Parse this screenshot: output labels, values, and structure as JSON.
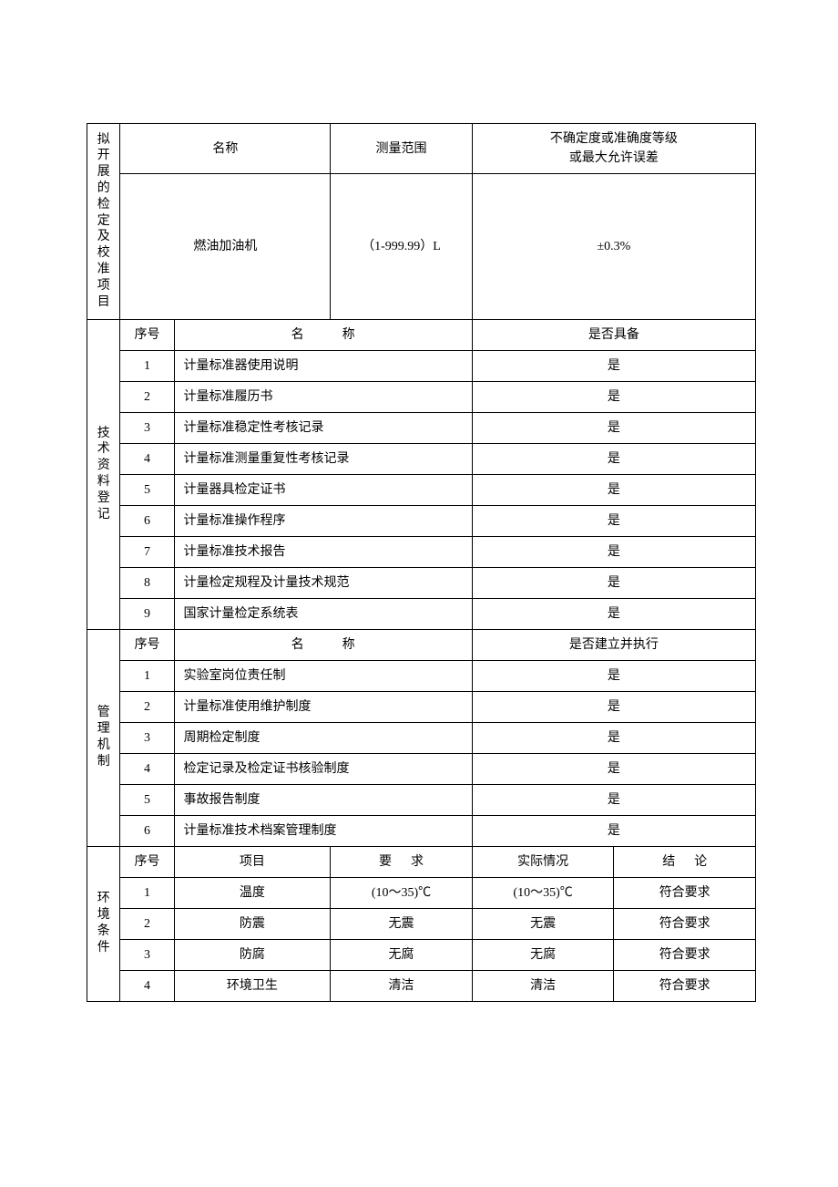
{
  "section1": {
    "label": "拟开展的检定及校准项目",
    "headers": {
      "name": "名称",
      "range": "测量范围",
      "uncertainty": "不确定度或准确度等级\n或最大允许误差"
    },
    "row": {
      "name": "燃油加油机",
      "range": "（1-999.99）L",
      "uncertainty": "±0.3%"
    }
  },
  "section2": {
    "label": "技术资料登记",
    "headers": {
      "seq": "序号",
      "name": "名　　称",
      "status": "是否具备"
    },
    "rows": [
      {
        "seq": "1",
        "name": "计量标准器使用说明",
        "status": "是"
      },
      {
        "seq": "2",
        "name": "计量标准履历书",
        "status": "是"
      },
      {
        "seq": "3",
        "name": "计量标准稳定性考核记录",
        "status": "是"
      },
      {
        "seq": "4",
        "name": "计量标准测量重复性考核记录",
        "status": "是"
      },
      {
        "seq": "5",
        "name": "计量器具检定证书",
        "status": "是"
      },
      {
        "seq": "6",
        "name": "计量标准操作程序",
        "status": "是"
      },
      {
        "seq": "7",
        "name": "计量标准技术报告",
        "status": "是"
      },
      {
        "seq": "8",
        "name": "计量检定规程及计量技术规范",
        "status": "是"
      },
      {
        "seq": "9",
        "name": "国家计量检定系统表",
        "status": "是"
      }
    ]
  },
  "section3": {
    "label": "管理机制",
    "headers": {
      "seq": "序号",
      "name": "名　　称",
      "status": "是否建立并执行"
    },
    "rows": [
      {
        "seq": "1",
        "name": "实验室岗位责任制",
        "status": "是"
      },
      {
        "seq": "2",
        "name": "计量标准使用维护制度",
        "status": "是"
      },
      {
        "seq": "3",
        "name": "周期检定制度",
        "status": "是"
      },
      {
        "seq": "4",
        "name": "检定记录及检定证书核验制度",
        "status": "是"
      },
      {
        "seq": "5",
        "name": "事故报告制度",
        "status": "是"
      },
      {
        "seq": "6",
        "name": "计量标准技术档案管理制度",
        "status": "是"
      }
    ]
  },
  "section4": {
    "label": "环境条件",
    "headers": {
      "seq": "序号",
      "item": "项目",
      "req": "要　求",
      "actual": "实际情况",
      "conclusion": "结　论"
    },
    "rows": [
      {
        "seq": "1",
        "item": "温度",
        "req": "(10～35)℃",
        "actual": "(10～35)℃",
        "conclusion": "符合要求"
      },
      {
        "seq": "2",
        "item": "防震",
        "req": "无震",
        "actual": "无震",
        "conclusion": "符合要求"
      },
      {
        "seq": "3",
        "item": "防腐",
        "req": "无腐",
        "actual": "无腐",
        "conclusion": "符合要求"
      },
      {
        "seq": "4",
        "item": "环境卫生",
        "req": "清洁",
        "actual": "清洁",
        "conclusion": "符合要求"
      }
    ]
  }
}
